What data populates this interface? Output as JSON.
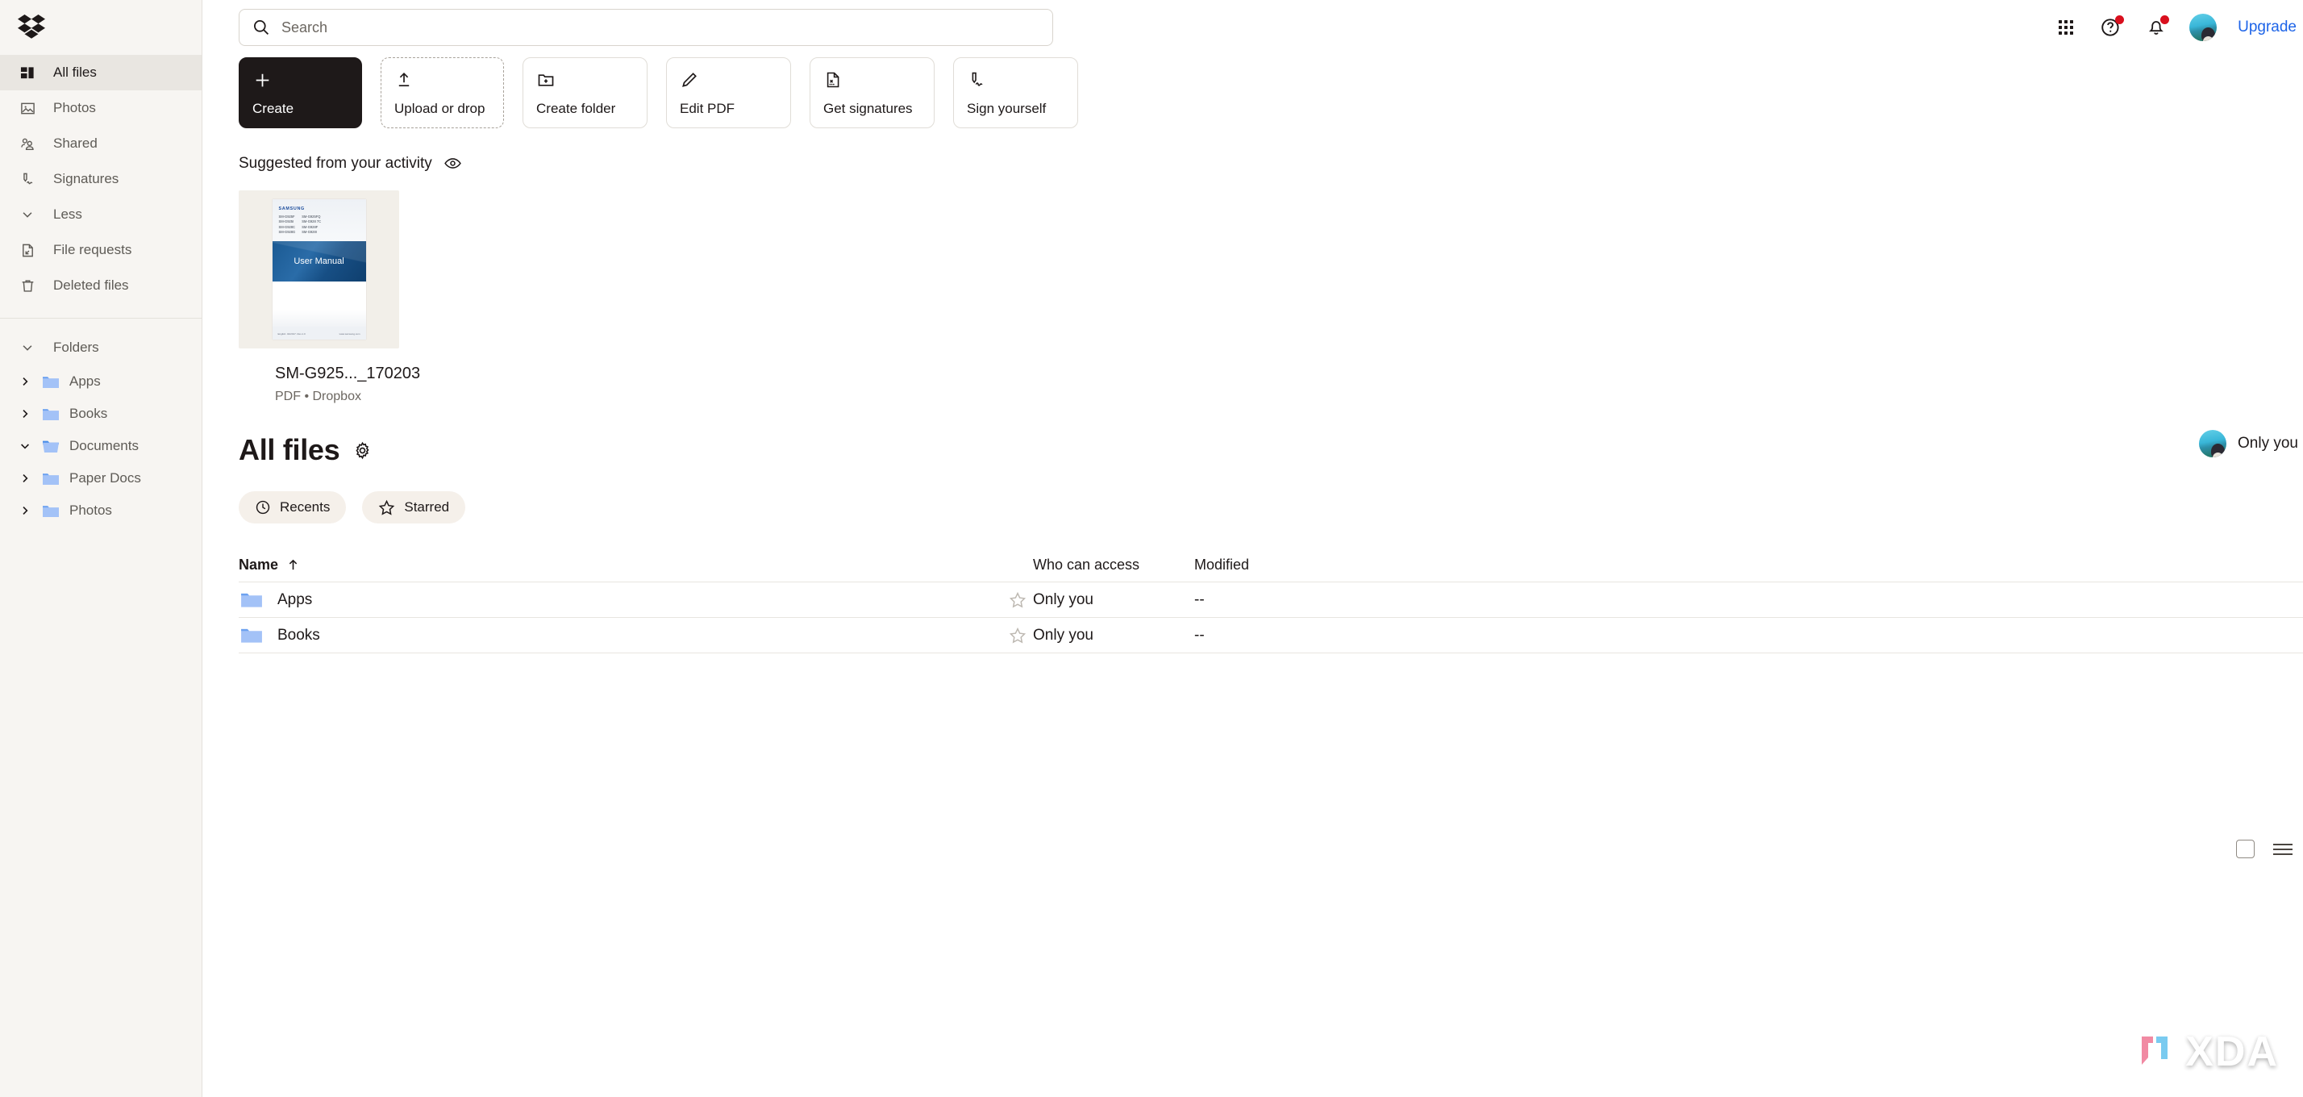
{
  "brand": {
    "logo": "dropbox-logo"
  },
  "sidebar": {
    "nav": [
      {
        "label": "All files",
        "icon": "all-files-icon",
        "active": true
      },
      {
        "label": "Photos",
        "icon": "photos-icon",
        "active": false
      },
      {
        "label": "Shared",
        "icon": "shared-icon",
        "active": false
      },
      {
        "label": "Signatures",
        "icon": "signature-icon",
        "active": false
      },
      {
        "label": "Less",
        "icon": "chevron-down-icon",
        "active": false
      },
      {
        "label": "File requests",
        "icon": "file-request-icon",
        "active": false
      },
      {
        "label": "Deleted files",
        "icon": "trash-icon",
        "active": false
      }
    ],
    "folders_header": {
      "label": "Folders",
      "icon": "chevron-down-icon"
    },
    "folders": [
      {
        "label": "Apps",
        "expanded": false
      },
      {
        "label": "Books",
        "expanded": false
      },
      {
        "label": "Documents",
        "expanded": true
      },
      {
        "label": "Paper Docs",
        "expanded": false
      },
      {
        "label": "Photos",
        "expanded": false
      }
    ]
  },
  "topbar": {
    "search": {
      "placeholder": "Search",
      "value": "",
      "icon": "search-icon"
    },
    "grid_icon": "apps-grid-icon",
    "help_icon": "help-circle-icon",
    "bell_icon": "notification-bell-icon",
    "avatar": "user-avatar",
    "upgrade_label": "Upgrade"
  },
  "actions": [
    {
      "label": "Create",
      "icon": "plus-icon",
      "style": "primary"
    },
    {
      "label": "Upload or drop",
      "icon": "upload-arrow-icon",
      "style": "dashed"
    },
    {
      "label": "Create folder",
      "icon": "folder-plus-icon",
      "style": "default"
    },
    {
      "label": "Edit PDF",
      "icon": "pencil-icon",
      "style": "default"
    },
    {
      "label": "Get signatures",
      "icon": "document-signature-icon",
      "style": "default"
    },
    {
      "label": "Sign yourself",
      "icon": "pen-sign-icon",
      "style": "default"
    }
  ],
  "suggested": {
    "heading": "Suggested from your activity",
    "eye_icon": "eye-icon",
    "card": {
      "name": "SM-G925..._170203",
      "meta": "PDF • Dropbox",
      "thumbnail": {
        "brand": "SAMSUNG",
        "models_left": [
          "SM-G925F",
          "SM-G925I",
          "SM-G928C",
          "SM-G928G"
        ],
        "models_right": [
          "SM-G925FQ",
          "SM-G928 7C",
          "SM-G928F",
          "SM-G928I"
        ],
        "title": "User Manual",
        "footer_left": "English. 02/2017. Rev.1.0",
        "footer_right": "www.samsung.com"
      }
    }
  },
  "all_files": {
    "title": "All files",
    "gear_icon": "gear-icon",
    "access_label": "Only you",
    "chips": [
      {
        "label": "Recents",
        "icon": "clock-icon"
      },
      {
        "label": "Starred",
        "icon": "star-icon"
      }
    ],
    "view": {
      "checkbox_icon": "checkbox-icon",
      "list_icon": "list-view-icon"
    },
    "columns": {
      "name": "Name",
      "sort_icon": "sort-asc-arrow-icon",
      "access": "Who can access",
      "modified": "Modified"
    },
    "rows": [
      {
        "name": "Apps",
        "icon": "folder-icon",
        "star": "star-outline-icon",
        "access": "Only you",
        "modified": "--"
      },
      {
        "name": "Books",
        "icon": "folder-icon",
        "star": "star-outline-icon",
        "access": "Only you",
        "modified": "--"
      }
    ]
  },
  "watermark": {
    "text": "XDA"
  }
}
